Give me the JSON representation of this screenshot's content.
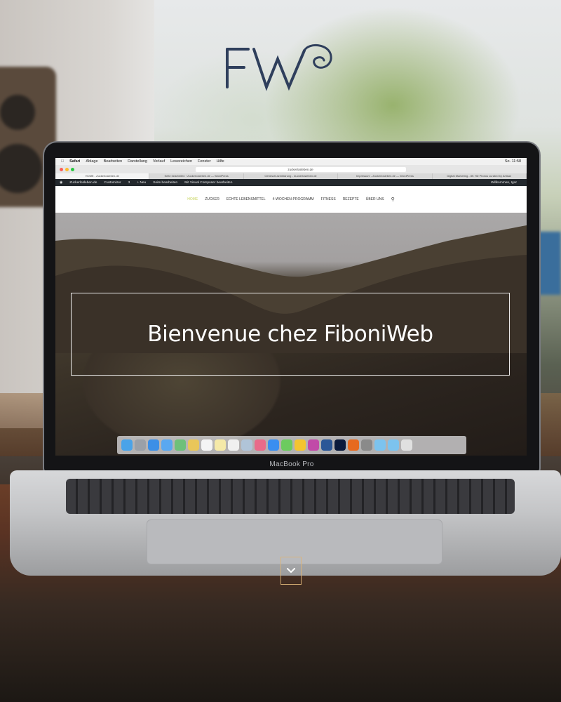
{
  "brand": {
    "logo_text": "FW",
    "logo_color": "#2f3f5c"
  },
  "menubar": {
    "items": [
      "Safari",
      "Ablage",
      "Bearbeiten",
      "Darstellung",
      "Verlauf",
      "Lesezeichen",
      "Fenster",
      "Hilfe"
    ],
    "clock": "So. 11:58"
  },
  "browser": {
    "url": "zuckerlosleben.de",
    "tabs": [
      "HOME - Zuckerlosleben.de",
      "Seite bearbeiten ‹ Zuckerlosleben.de — WordPress",
      "Geheschutzerklärung - Zuckerlosleben.de",
      "Impressum - Zuckerlosleben.de — WordPress",
      "Digital Marketing - 8K HD Photos curated by Artisan"
    ],
    "active_tab": 0
  },
  "wp_admin_bar": {
    "site": "Zuckerlosleben.de",
    "customizer": "Customizer",
    "comments": "3",
    "new": "+ Neu",
    "edit": "Seite bearbeiten",
    "composer": "Mit Visual Composer bearbeiten",
    "greeting": "Willkommen, Igor"
  },
  "site_nav": {
    "items": [
      "HOME",
      "ZUCKER",
      "ECHTE LEBENSMITTEL",
      "4-WOCHEN-PROGRAMM",
      "FITNESS",
      "REZEPTE",
      "ÜBER UNS"
    ],
    "active": 0
  },
  "hero": {
    "headline": "Bienvenue chez FiboniWeb"
  },
  "laptop": {
    "model_label": "MacBook Pro"
  },
  "colors": {
    "accent": "#c6d35a",
    "scroll_border": "#dcb478"
  },
  "dock_icons": [
    "finder-icon",
    "launchpad-icon",
    "safari-icon",
    "mail-icon",
    "maps-icon",
    "photos-icon",
    "calendar-icon",
    "notes-icon",
    "reminders-icon",
    "preview-icon",
    "photos-alt-icon",
    "app-store-icon",
    "messages-icon",
    "drive-icon",
    "terminal-icon",
    "word-icon",
    "photoshop-icon",
    "firefox-icon",
    "utility-icon",
    "folder-icon",
    "folder-icon",
    "downloads-icon",
    "trash-icon"
  ]
}
